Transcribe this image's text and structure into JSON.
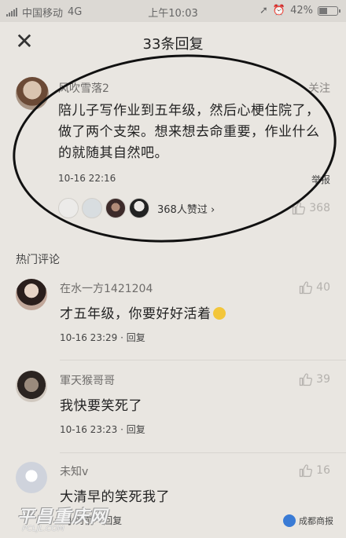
{
  "statusbar": {
    "carrier": "中国移动",
    "network": "4G",
    "time": "上午10:03",
    "battery": "42%"
  },
  "header": {
    "title": "33条回复",
    "close_icon": "close-icon"
  },
  "main_comment": {
    "username": "风吹雪落2",
    "follow_label": "关注",
    "text": "陪儿子写作业到五年级，然后心梗住院了，做了两个支架。想来想去命重要，作业什么的就随其自然吧。",
    "time": "10-16 22:16",
    "report_label": "举报",
    "liked_by": "368人赞过 ›",
    "like_count": "368"
  },
  "hot_comments": {
    "title": "热门评论",
    "items": [
      {
        "username": "在水一方1421204",
        "text": "才五年级，你要好好活着",
        "time": "10-16 23:29 · 回复",
        "likes": "40"
      },
      {
        "username": "軍天猴哥哥",
        "text": "我快要笑死了",
        "time": "10-16 23:23 · 回复",
        "likes": "39"
      },
      {
        "username": "未知v",
        "text": "大清早的笑死我了",
        "time": "2小时前 · 回复",
        "likes": "16"
      }
    ]
  },
  "watermarks": {
    "left": "平昌重庆网",
    "left_sub": "PCLJL.COM",
    "right": "成都商报"
  },
  "colors": {
    "background": "#e9e6e1",
    "like_grey": "#b4b1ad"
  }
}
